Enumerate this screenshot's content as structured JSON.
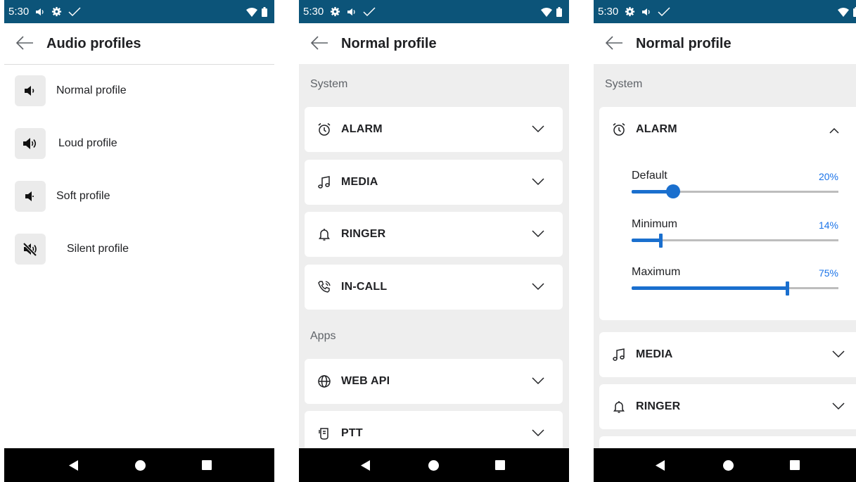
{
  "status": {
    "time": "5:30"
  },
  "screens": [
    {
      "title": "Audio profiles",
      "profiles": [
        {
          "label": "Normal profile",
          "icon": "volume-low-icon"
        },
        {
          "label": "Loud profile",
          "icon": "volume-high-icon"
        },
        {
          "label": "Soft profile",
          "icon": "volume-soft-icon"
        },
        {
          "label": "Silent profile",
          "icon": "volume-mute-icon"
        }
      ]
    },
    {
      "title": "Normal profile",
      "sections": [
        {
          "label": "System",
          "items": [
            "ALARM",
            "MEDIA",
            "RINGER",
            "IN-CALL"
          ]
        },
        {
          "label": "Apps",
          "items": [
            "WEB API",
            "PTT"
          ]
        }
      ]
    },
    {
      "title": "Normal profile",
      "section": "System",
      "alarm": {
        "title": "ALARM",
        "sliders": [
          {
            "label": "Default",
            "value": "20%",
            "level": 0.2
          },
          {
            "label": "Minimum",
            "value": "14%",
            "level": 0.14
          },
          {
            "label": "Maximum",
            "value": "75%",
            "level": 0.75
          }
        ]
      },
      "items": [
        "MEDIA",
        "RINGER"
      ]
    }
  ],
  "colors": {
    "statusbar": "#0c5479",
    "accent": "#1a73e8",
    "background": "#eeeeee"
  }
}
